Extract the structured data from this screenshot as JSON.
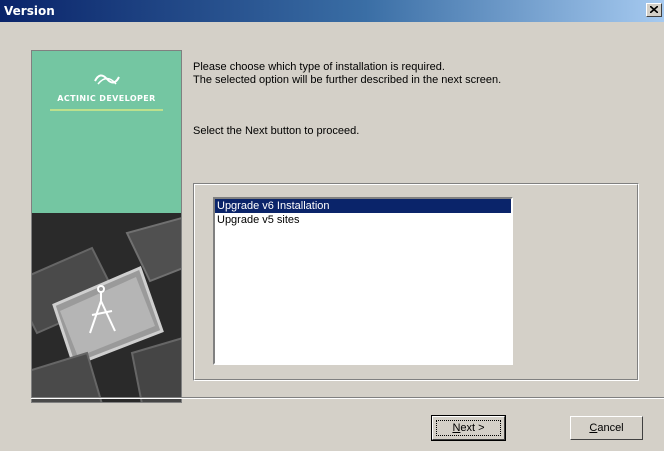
{
  "window": {
    "title": "Version",
    "close_icon": "close-icon"
  },
  "brand": {
    "name": "ACTINIC DEVELOPER",
    "logo_icon": "actinic-logo-icon"
  },
  "instructions": {
    "line1": "Please choose which type of installation is required.",
    "line2": "The selected option will be further described in the next screen.",
    "line3": "Select the Next button to proceed."
  },
  "installation_options": {
    "items": [
      {
        "label": "Upgrade v6 Installation",
        "selected": true
      },
      {
        "label": "Upgrade v5 sites",
        "selected": false
      }
    ]
  },
  "buttons": {
    "next_accesskey": "N",
    "next_rest": "ext >",
    "cancel_accesskey": "C",
    "cancel_rest": "ancel"
  },
  "colors": {
    "title_bar": "#0a246a",
    "brand_green": "#74c6a2",
    "selection": "#0a246a",
    "dialog_bg": "#d4d0c8"
  }
}
